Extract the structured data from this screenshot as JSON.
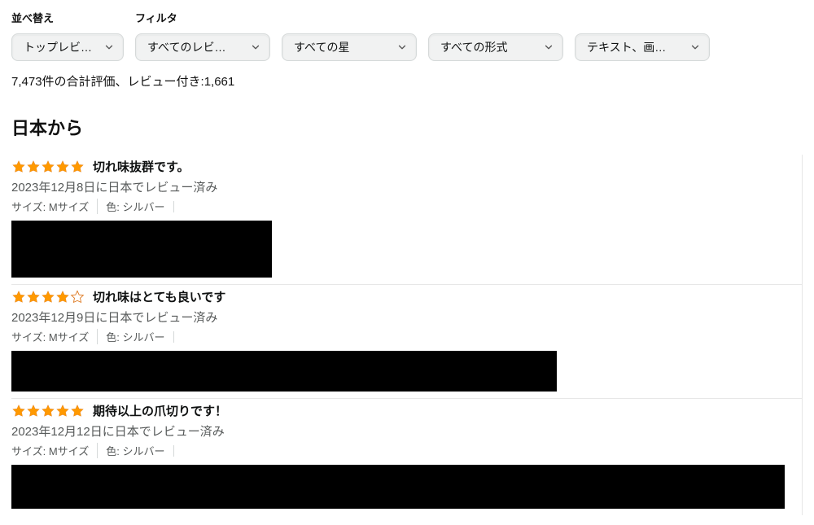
{
  "labels": {
    "sort": "並べ替え",
    "filter": "フィルタ"
  },
  "dropdowns": {
    "sort": "トップレビ…",
    "reviewer": "すべてのレビ…",
    "star": "すべての星",
    "format": "すべての形式",
    "media": "テキスト、画…"
  },
  "summary": "7,473件の合計評価、レビュー付き:1,661",
  "section_title": "日本から",
  "attr_labels": {
    "size": "サイズ: ",
    "color": "色: "
  },
  "reviews": [
    {
      "rating": 5,
      "title": "切れ味抜群です。",
      "date": "2023年12月8日に日本でレビュー済み",
      "size": "Mサイズ",
      "color": "シルバー"
    },
    {
      "rating": 4,
      "title": "切れ味はとても良いです",
      "date": "2023年12月9日に日本でレビュー済み",
      "size": "Mサイズ",
      "color": "シルバー"
    },
    {
      "rating": 5,
      "title": "期待以上の爪切りです！",
      "date": "2023年12月12日に日本でレビュー済み",
      "size": "Mサイズ",
      "color": "シルバー"
    }
  ]
}
